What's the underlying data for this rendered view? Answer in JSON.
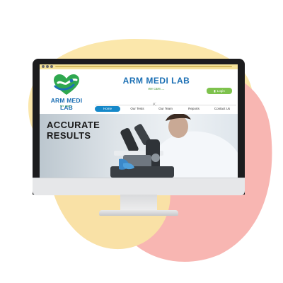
{
  "site": {
    "title": "ARM MEDI LAB",
    "tagline": "we care....",
    "logo_name": "ARM MEDI LAB",
    "logo_tagline": "We care...",
    "login_label": "Login"
  },
  "nav": {
    "items": [
      {
        "label": "Home",
        "active": true
      },
      {
        "label": "Our Tests",
        "active": false
      },
      {
        "label": "Our Team",
        "active": false
      },
      {
        "label": "Reports",
        "active": false
      },
      {
        "label": "Contact Us",
        "active": false
      }
    ]
  },
  "hero": {
    "line1": "ACCURATE",
    "line2": "RESULTS"
  },
  "colors": {
    "brand_blue": "#1b6fb4",
    "nav_active": "#1588c9",
    "login_green": "#7ec24d",
    "blob_yellow": "#fbe7ab",
    "blob_pink": "#f8b6b2"
  }
}
